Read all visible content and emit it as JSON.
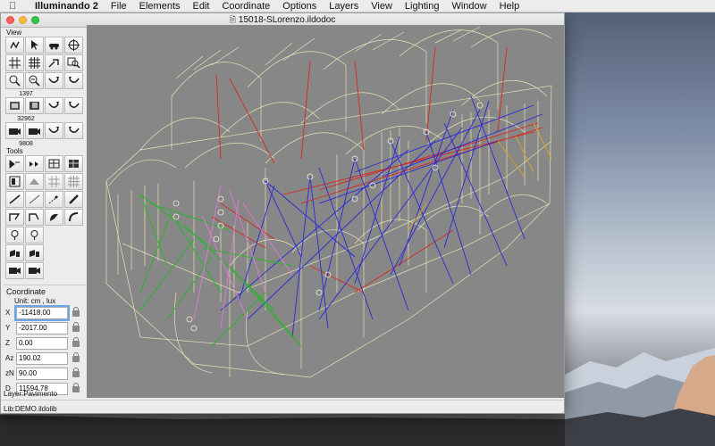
{
  "menubar": {
    "apple": "",
    "app_name": "Illuminando 2",
    "items": [
      "File",
      "Elements",
      "Edit",
      "Coordinate",
      "Options",
      "Layers",
      "View",
      "Lighting",
      "Window",
      "Help"
    ]
  },
  "window": {
    "title": "15018-SLorenzo.ildodoc"
  },
  "palette": {
    "view_label": "View",
    "tools_label": "Tools",
    "counts": [
      "1397",
      "32962",
      "9808"
    ]
  },
  "coordinate": {
    "title": "Coordinate",
    "unit": "Unit: cm ,  lux",
    "fields": [
      {
        "label": "X",
        "value": "-11418.00"
      },
      {
        "label": "Y",
        "value": "-2017.00"
      },
      {
        "label": "Z",
        "value": "0.00"
      },
      {
        "label": "Az",
        "value": "190.02"
      },
      {
        "label": "zN",
        "value": "90.00"
      },
      {
        "label": "D",
        "value": "11594.78"
      }
    ]
  },
  "status": {
    "layer": "Layer:Pavimento",
    "lib": "Lib:DEMO.ildolib"
  },
  "colors": {
    "canvas_bg": "#878787",
    "wireframe": "#e6e3b4",
    "blue_rays": "#2a2ad6",
    "red_rays": "#d6281e",
    "green_rays": "#22b822",
    "pink_rays": "#e07ad6",
    "orange_rays": "#e6a21e"
  }
}
